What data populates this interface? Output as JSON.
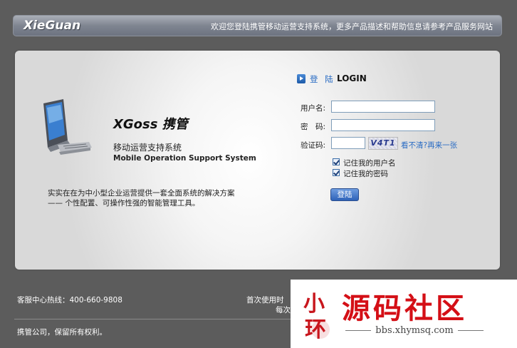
{
  "header": {
    "logo": "XieGuan",
    "welcome": "欢迎您登陆携管移动运营支持系统，更多产品描述和帮助信息请参考产品服务网站"
  },
  "intro": {
    "product_title": "XGoss 携管",
    "subtitle_cn": "移动运营支持系统",
    "subtitle_en": "Mobile Operation Support System",
    "desc_line1": "实实在在为中小型企业运营提供一套全面系统的解决方案",
    "desc_line2": "—— 个性配置、可操作性强的智能管理工具。"
  },
  "login": {
    "head_cn": "登 陆",
    "head_en": "LOGIN",
    "username_label": "用户名:",
    "username_value": "",
    "password_label": "密　码:",
    "password_value": "",
    "captcha_label": "验证码:",
    "captcha_value": "",
    "captcha_text": "V4T1",
    "captcha_refresh": "看不清?再来一张",
    "remember_username": "记住我的用户名",
    "remember_username_checked": true,
    "remember_password": "记住我的密码",
    "remember_password_checked": true,
    "submit": "登陆"
  },
  "footer": {
    "hotline": "客服中心热线：400-660-9808",
    "first_use": "首次使用时",
    "first_use_2": "每次",
    "copyright": "携管公司，保留所有权利。"
  },
  "watermark": {
    "seal_text": "小环",
    "title": "源码社区",
    "url": "bbs.xhymsq.com"
  },
  "colors": {
    "background": "#5c5c5c",
    "link_blue": "#2a6cc4",
    "watermark_red": "#d40f16"
  }
}
